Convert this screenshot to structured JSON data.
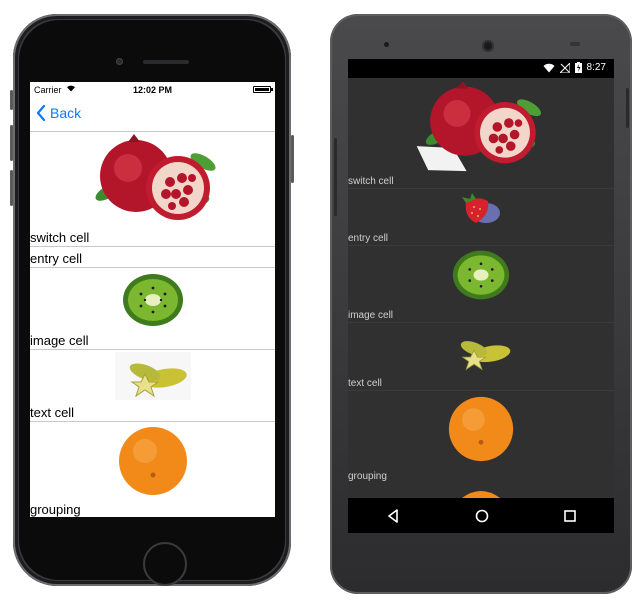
{
  "ios": {
    "status": {
      "carrier": "Carrier",
      "time": "12:02 PM"
    },
    "nav": {
      "back_label": "Back"
    },
    "cells": [
      {
        "label": "switch cell",
        "image": "pomegranate"
      },
      {
        "label": "entry cell",
        "image": ""
      },
      {
        "label": "image cell",
        "image": "kiwi"
      },
      {
        "label": "text cell",
        "image": "carambola"
      },
      {
        "label": "grouping",
        "image": "orange"
      }
    ]
  },
  "android": {
    "status": {
      "time": "8:27"
    },
    "cells": [
      {
        "label": "switch cell",
        "image": "pomegranate"
      },
      {
        "label": "entry cell",
        "image": "strawberry"
      },
      {
        "label": "image cell",
        "image": "kiwi"
      },
      {
        "label": "text cell",
        "image": "carambola"
      },
      {
        "label": "grouping",
        "image": "orange"
      }
    ],
    "nav_buttons": [
      "back-icon",
      "home-icon",
      "recents-icon"
    ]
  },
  "colors": {
    "ios_accent": "#0a7aff",
    "android_bg": "#303030"
  }
}
